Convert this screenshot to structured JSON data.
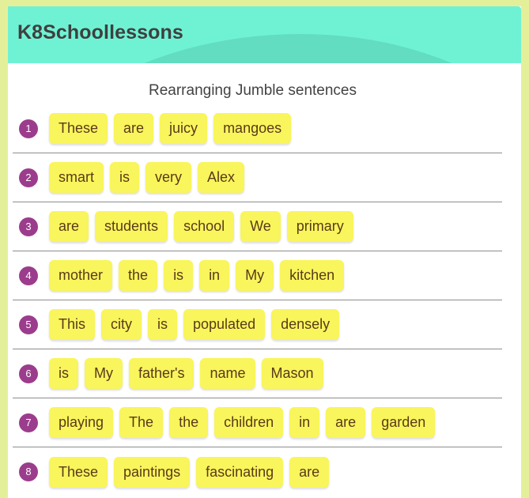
{
  "header": {
    "logo_text": "K8Schoollessons"
  },
  "main": {
    "title": "Rearranging Jumble sentences",
    "rows": [
      {
        "number": "1",
        "words": [
          "These",
          "are",
          "juicy",
          "mangoes"
        ]
      },
      {
        "number": "2",
        "words": [
          "smart",
          "is",
          "very",
          "Alex"
        ]
      },
      {
        "number": "3",
        "words": [
          "are",
          "students",
          "school",
          "We",
          "primary"
        ]
      },
      {
        "number": "4",
        "words": [
          "mother",
          "the",
          "is",
          "in",
          "My",
          "kitchen"
        ]
      },
      {
        "number": "5",
        "words": [
          "This",
          "city",
          "is",
          "populated",
          "densely"
        ]
      },
      {
        "number": "6",
        "words": [
          "is",
          "My",
          "father's",
          "name",
          "Mason"
        ]
      },
      {
        "number": "7",
        "words": [
          "playing",
          "The",
          "the",
          "children",
          "in",
          "are",
          "garden"
        ]
      },
      {
        "number": "8",
        "words": [
          "These",
          "paintings",
          "fascinating",
          "are"
        ]
      }
    ]
  },
  "colors": {
    "page_background": "#e4f099",
    "header_teal": "#6ff2d4",
    "header_swoosh": "#62ddc2",
    "tile_yellow": "#f9f55c",
    "tile_text": "#5a3a1a",
    "badge_purple": "#9b3d8c",
    "title_text": "#434343"
  }
}
